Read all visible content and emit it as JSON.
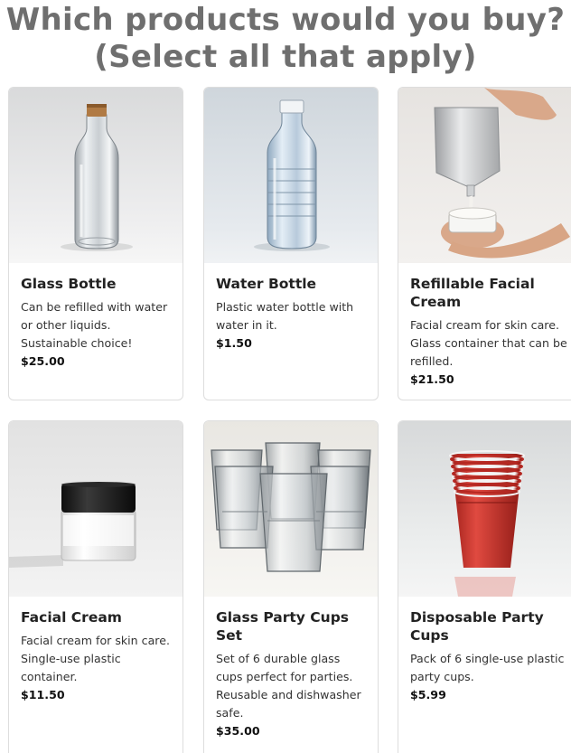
{
  "page": {
    "title_line1": "Which products would you buy?",
    "title_line2": "(Select all that apply)"
  },
  "products": [
    {
      "name": "Glass Bottle",
      "description": "Can be refilled with water or other liquids. Sustainable choice!",
      "price": "$25.00",
      "image_icon": "glass-bottle-photo"
    },
    {
      "name": "Water Bottle",
      "description": "Plastic water bottle with water in it.",
      "price": "$1.50",
      "image_icon": "plastic-water-bottle-photo"
    },
    {
      "name": "Refillable Facial Cream",
      "description": "Facial cream for skin care. Glass container that can be refilled.",
      "price": "$21.50",
      "image_icon": "refill-pouch-and-cream-photo"
    },
    {
      "name": "Facial Cream",
      "description": "Facial cream for skin care. Single-use plastic container.",
      "price": "$11.50",
      "image_icon": "cream-jar-photo"
    },
    {
      "name": "Glass Party Cups Set",
      "description": "Set of 6 durable glass cups perfect for parties. Reusable and dishwasher safe.",
      "price": "$35.00",
      "image_icon": "glass-cups-photo"
    },
    {
      "name": "Disposable Party Cups",
      "description": "Pack of 6 single-use plastic party cups.",
      "price": "$5.99",
      "image_icon": "red-plastic-cups-photo"
    }
  ],
  "colors": {
    "title": "#6f6f6f",
    "card_border": "#dddddd",
    "red_cup": "#d0322c"
  }
}
